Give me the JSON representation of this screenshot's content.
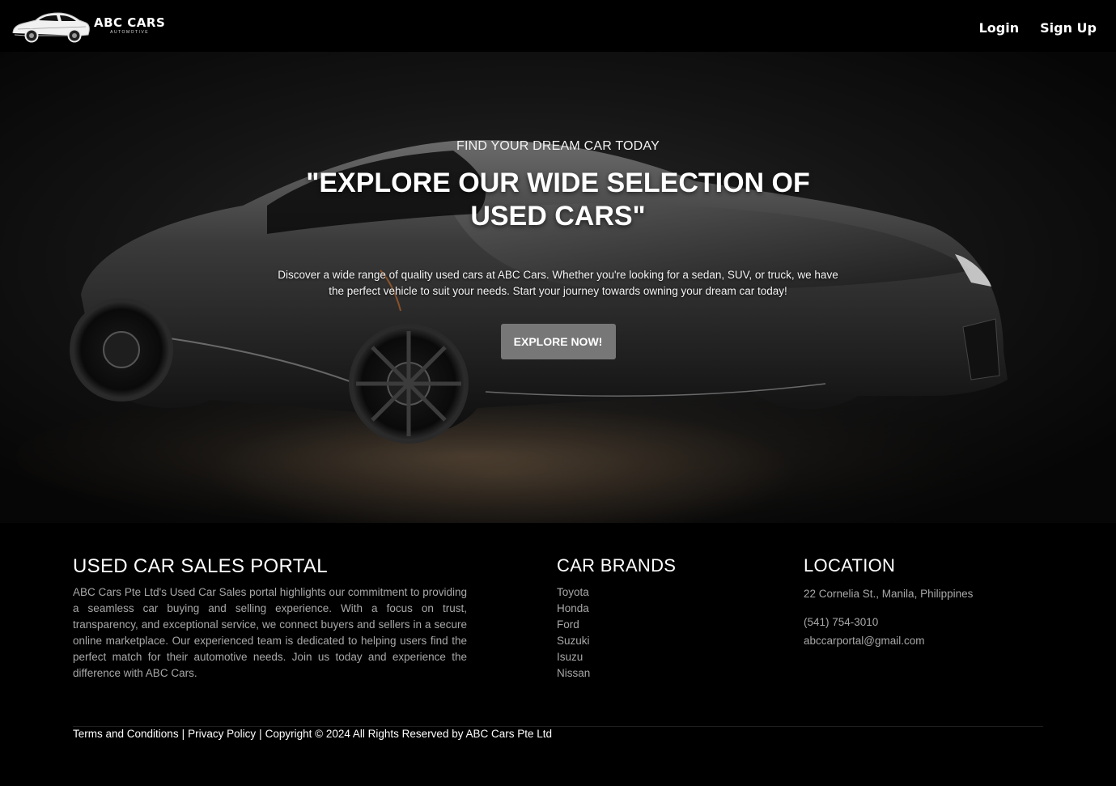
{
  "brand": {
    "name": "ABC CARS",
    "subtitle": "AUTOMOTIVE",
    "logo_icon": "car-icon"
  },
  "nav": {
    "login_label": "Login",
    "signup_label": "Sign Up"
  },
  "hero": {
    "kicker": "FIND YOUR DREAM CAR TODAY",
    "title": "\"EXPLORE OUR WIDE SELECTION OF USED CARS\"",
    "description": "Discover a wide range of quality used cars at ABC Cars. Whether you're looking for a sedan, SUV, or truck, we have the perfect vehicle to suit your needs. Start your journey towards owning your dream car today!",
    "button_label": "EXPLORE NOW!",
    "button_color": "#777777",
    "background_image": "black-sports-car"
  },
  "footer": {
    "about": {
      "title": "USED CAR SALES PORTAL",
      "text": "ABC Cars Pte Ltd's Used Car Sales portal highlights our commitment to providing a seamless car buying and selling experience. With a focus on trust, transparency, and exceptional service, we connect buyers and sellers in a secure online marketplace. Our experienced team is dedicated to helping users find the perfect match for their automotive needs. Join us today and experience the difference with ABC Cars."
    },
    "brands": {
      "title": "CAR BRANDS",
      "items": [
        "Toyota",
        "Honda",
        "Ford",
        "Suzuki",
        "Isuzu",
        "Nissan"
      ]
    },
    "location": {
      "title": "LOCATION",
      "address": "22 Cornelia St., Manila, Philippines",
      "phone": "(541) 754-3010",
      "email": "abccarportal@gmail.com"
    },
    "legal": {
      "terms": "Terms and Conditions",
      "separator1": "|",
      "privacy": "Privacy Policy",
      "separator2": "|",
      "copyright": "Copyright © 2024 All Rights Reserved by ABC Cars Pte Ltd"
    }
  }
}
